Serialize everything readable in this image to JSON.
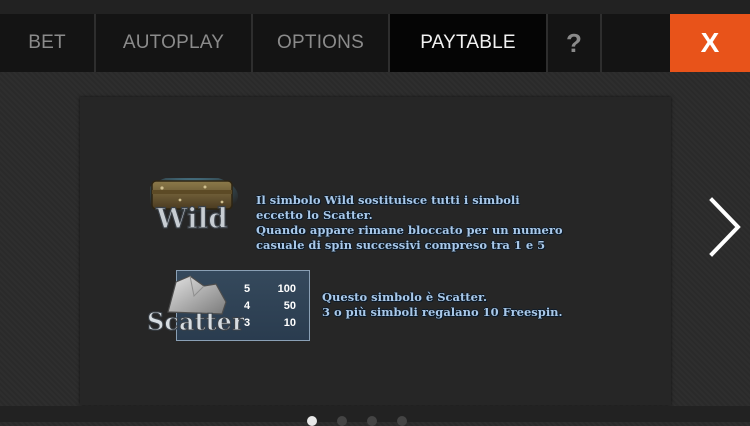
{
  "tabs": {
    "bet": "BET",
    "autoplay": "AUTOPLAY",
    "options": "OPTIONS",
    "paytable": "PAYTABLE",
    "help": "?",
    "close": "X"
  },
  "wild": {
    "symbol_label": "Wild",
    "description": [
      "Il simbolo Wild sostituisce tutti i simboli",
      "eccetto lo Scatter.",
      "Quando appare rimane bloccato per un numero",
      "casuale di spin successivi compreso tra 1 e 5"
    ]
  },
  "scatter": {
    "symbol_label": "Scatter",
    "payouts": [
      {
        "count": "5",
        "value": "100"
      },
      {
        "count": "4",
        "value": "50"
      },
      {
        "count": "3",
        "value": "10"
      }
    ],
    "description": [
      "Questo simbolo è Scatter.",
      "3 o più simboli regalano 10 Freespin."
    ]
  },
  "pagination": {
    "active_page": 1,
    "total_pages": 4
  },
  "colors": {
    "accent": "#e8531a",
    "text_blue": "#a9c8e8"
  },
  "icons": {
    "next": "chevron-right-icon"
  }
}
